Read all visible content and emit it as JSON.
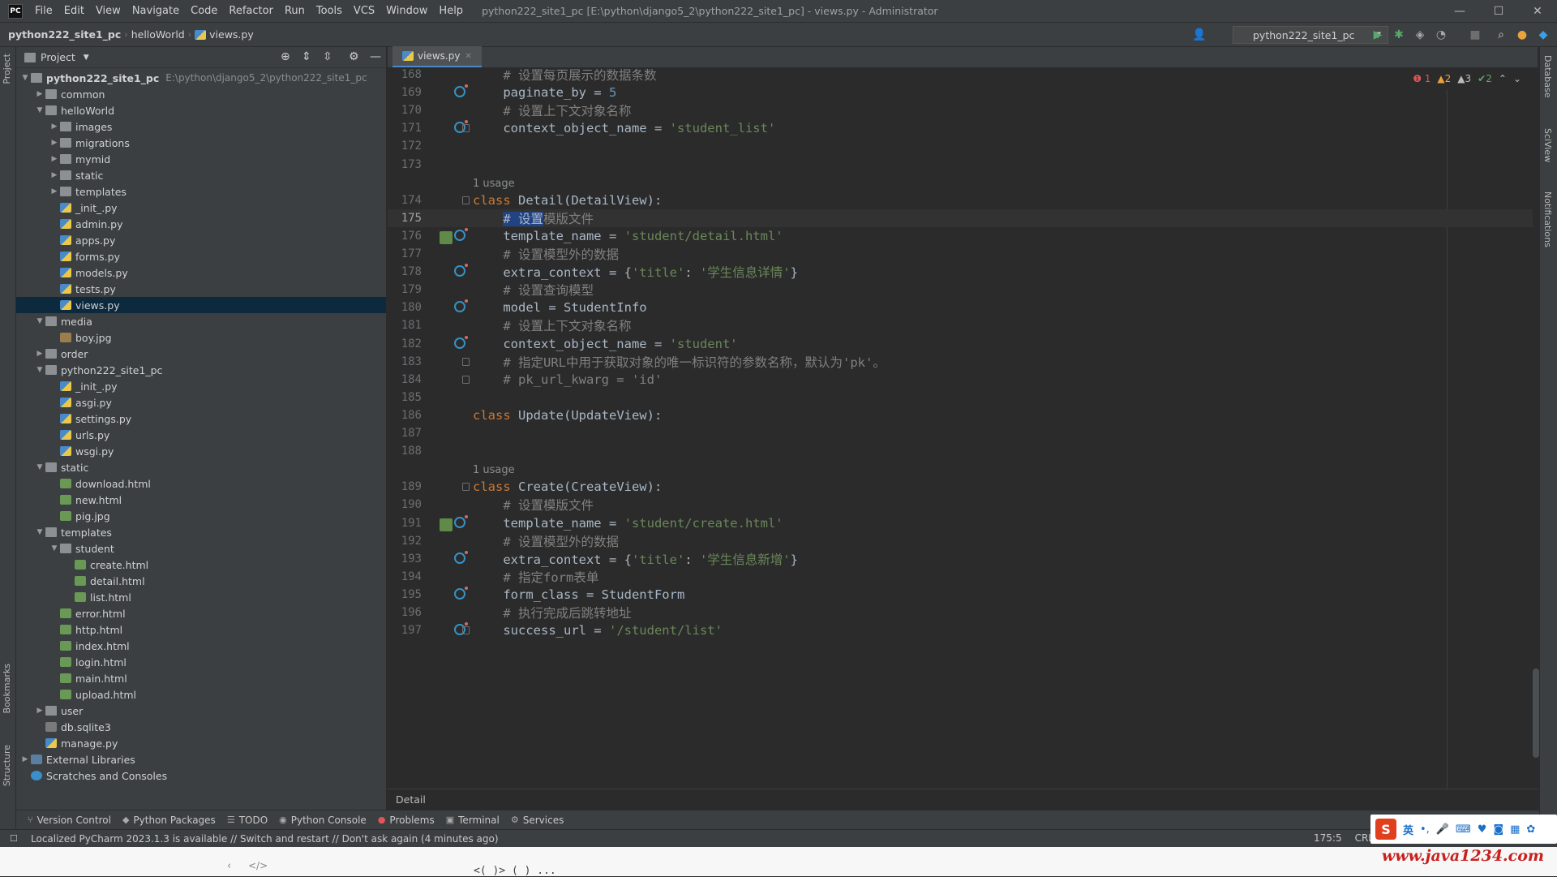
{
  "titlebar": {
    "logo": "PC",
    "menu": [
      "File",
      "Edit",
      "View",
      "Navigate",
      "Code",
      "Refactor",
      "Run",
      "Tools",
      "VCS",
      "Window",
      "Help"
    ],
    "window_title": "python222_site1_pc [E:\\python\\django5_2\\python222_site1_pc] - views.py - Administrator"
  },
  "navbar": {
    "crumbs": [
      "python222_site1_pc",
      "helloWorld",
      "views.py"
    ],
    "run_config": "python222_site1_pc"
  },
  "left_stripe": {
    "project": "Project",
    "bookmarks": "Bookmarks",
    "structure": "Structure"
  },
  "right_stripe": {
    "database": "Database",
    "sciview": "SciView",
    "notifications": "Notifications"
  },
  "project_panel": {
    "title": "Project",
    "tree": [
      {
        "label": "python222_site1_pc",
        "hint": "E:\\python\\django5_2\\python222_site1_pc",
        "type": "folder",
        "depth": 0,
        "arrow": "open",
        "bold": true
      },
      {
        "label": "common",
        "type": "folder",
        "depth": 1,
        "arrow": "closed"
      },
      {
        "label": "helloWorld",
        "type": "folder",
        "depth": 1,
        "arrow": "open"
      },
      {
        "label": "images",
        "type": "folder",
        "depth": 2,
        "arrow": "closed"
      },
      {
        "label": "migrations",
        "type": "folder",
        "depth": 2,
        "arrow": "closed"
      },
      {
        "label": "mymid",
        "type": "folder",
        "depth": 2,
        "arrow": "closed"
      },
      {
        "label": "static",
        "type": "folder",
        "depth": 2,
        "arrow": "closed"
      },
      {
        "label": "templates",
        "type": "folder",
        "depth": 2,
        "arrow": "closed"
      },
      {
        "label": "_init_.py",
        "type": "py",
        "depth": 2
      },
      {
        "label": "admin.py",
        "type": "py",
        "depth": 2
      },
      {
        "label": "apps.py",
        "type": "py",
        "depth": 2
      },
      {
        "label": "forms.py",
        "type": "py",
        "depth": 2
      },
      {
        "label": "models.py",
        "type": "py",
        "depth": 2
      },
      {
        "label": "tests.py",
        "type": "py",
        "depth": 2
      },
      {
        "label": "views.py",
        "type": "py",
        "depth": 2,
        "selected": true
      },
      {
        "label": "media",
        "type": "folder",
        "depth": 1,
        "arrow": "open"
      },
      {
        "label": "boy.jpg",
        "type": "jpg",
        "depth": 2
      },
      {
        "label": "order",
        "type": "folder",
        "depth": 1,
        "arrow": "closed"
      },
      {
        "label": "python222_site1_pc",
        "type": "folder",
        "depth": 1,
        "arrow": "open"
      },
      {
        "label": "_init_.py",
        "type": "py",
        "depth": 2
      },
      {
        "label": "asgi.py",
        "type": "py",
        "depth": 2
      },
      {
        "label": "settings.py",
        "type": "py",
        "depth": 2
      },
      {
        "label": "urls.py",
        "type": "py",
        "depth": 2
      },
      {
        "label": "wsgi.py",
        "type": "py",
        "depth": 2
      },
      {
        "label": "static",
        "type": "folder",
        "depth": 1,
        "arrow": "open"
      },
      {
        "label": "download.html",
        "type": "html",
        "depth": 2
      },
      {
        "label": "new.html",
        "type": "html",
        "depth": 2
      },
      {
        "label": "pig.jpg",
        "type": "html",
        "depth": 2
      },
      {
        "label": "templates",
        "type": "folder",
        "depth": 1,
        "arrow": "open"
      },
      {
        "label": "student",
        "type": "folder",
        "depth": 2,
        "arrow": "open"
      },
      {
        "label": "create.html",
        "type": "html",
        "depth": 3
      },
      {
        "label": "detail.html",
        "type": "html",
        "depth": 3
      },
      {
        "label": "list.html",
        "type": "html",
        "depth": 3
      },
      {
        "label": "error.html",
        "type": "html",
        "depth": 2
      },
      {
        "label": "http.html",
        "type": "html",
        "depth": 2
      },
      {
        "label": "index.html",
        "type": "html",
        "depth": 2
      },
      {
        "label": "login.html",
        "type": "html",
        "depth": 2
      },
      {
        "label": "main.html",
        "type": "html",
        "depth": 2
      },
      {
        "label": "upload.html",
        "type": "html",
        "depth": 2
      },
      {
        "label": "user",
        "type": "folder",
        "depth": 1,
        "arrow": "closed"
      },
      {
        "label": "db.sqlite3",
        "type": "db",
        "depth": 1
      },
      {
        "label": "manage.py",
        "type": "py",
        "depth": 1
      },
      {
        "label": "External Libraries",
        "type": "lib",
        "depth": 0,
        "arrow": "closed"
      },
      {
        "label": "Scratches and Consoles",
        "type": "scratch",
        "depth": 0
      }
    ]
  },
  "editor": {
    "tab": "views.py",
    "inspections": {
      "errors": "1",
      "warnings": "2",
      "weak": "3",
      "ok": "2"
    },
    "lines": [
      {
        "n": "168",
        "code": [
          [
            "cmt",
            "    # 设置每页展示的数据条数"
          ]
        ]
      },
      {
        "n": "169",
        "gutter": "o",
        "code": [
          [
            "cls",
            "    paginate_by = "
          ],
          [
            "num",
            "5"
          ]
        ]
      },
      {
        "n": "170",
        "code": [
          [
            "cmt",
            "    # 设置上下文对象名称"
          ]
        ]
      },
      {
        "n": "171",
        "gutter": "o",
        "fold": true,
        "code": [
          [
            "cls",
            "    context_object_name = "
          ],
          [
            "str",
            "'student_list'"
          ]
        ]
      },
      {
        "n": "172",
        "code": []
      },
      {
        "n": "173",
        "code": []
      },
      {
        "usage": "1 usage"
      },
      {
        "n": "174",
        "fold": true,
        "code": [
          [
            "kw",
            "class "
          ],
          [
            "cls",
            "Detail(DetailView):"
          ]
        ]
      },
      {
        "n": "175",
        "current": true,
        "code": [
          [
            "cmt",
            "    "
          ],
          [
            "sel",
            "# 设置"
          ],
          [
            "cmt",
            "模版文件"
          ]
        ]
      },
      {
        "n": "176",
        "gutter": "io",
        "code": [
          [
            "cls",
            "    template_name = "
          ],
          [
            "str",
            "'student/detail.html'"
          ]
        ]
      },
      {
        "n": "177",
        "code": [
          [
            "cmt",
            "    # 设置模型外的数据"
          ]
        ]
      },
      {
        "n": "178",
        "gutter": "o",
        "code": [
          [
            "cls",
            "    extra_context = {"
          ],
          [
            "str",
            "'title'"
          ],
          [
            "cls",
            ": "
          ],
          [
            "str",
            "'学生信息详情'"
          ],
          [
            "cls",
            "}"
          ]
        ]
      },
      {
        "n": "179",
        "code": [
          [
            "cmt",
            "    # 设置查询模型"
          ]
        ]
      },
      {
        "n": "180",
        "gutter": "o",
        "code": [
          [
            "cls",
            "    model = StudentInfo"
          ]
        ]
      },
      {
        "n": "181",
        "code": [
          [
            "cmt",
            "    # 设置上下文对象名称"
          ]
        ]
      },
      {
        "n": "182",
        "gutter": "o",
        "code": [
          [
            "cls",
            "    context_object_name = "
          ],
          [
            "str",
            "'student'"
          ]
        ]
      },
      {
        "n": "183",
        "fold": true,
        "code": [
          [
            "cmt",
            "    # 指定URL中用于获取对象的唯一标识符的参数名称，默认为'pk'。"
          ]
        ]
      },
      {
        "n": "184",
        "fold": true,
        "code": [
          [
            "cmt",
            "    # pk_url_kwarg = 'id'"
          ]
        ]
      },
      {
        "n": "185",
        "code": []
      },
      {
        "n": "186",
        "code": [
          [
            "kw",
            "class "
          ],
          [
            "cls",
            "Update(UpdateView):"
          ]
        ]
      },
      {
        "n": "187",
        "code": []
      },
      {
        "n": "188",
        "code": []
      },
      {
        "usage": "1 usage"
      },
      {
        "n": "189",
        "fold": true,
        "code": [
          [
            "kw",
            "class "
          ],
          [
            "cls",
            "Create(CreateView):"
          ]
        ]
      },
      {
        "n": "190",
        "code": [
          [
            "cmt",
            "    # 设置模版文件"
          ]
        ]
      },
      {
        "n": "191",
        "gutter": "io",
        "code": [
          [
            "cls",
            "    template_name = "
          ],
          [
            "str",
            "'student/create.html'"
          ]
        ]
      },
      {
        "n": "192",
        "code": [
          [
            "cmt",
            "    # 设置模型外的数据"
          ]
        ]
      },
      {
        "n": "193",
        "gutter": "o",
        "code": [
          [
            "cls",
            "    extra_context = {"
          ],
          [
            "str",
            "'title'"
          ],
          [
            "cls",
            ": "
          ],
          [
            "str",
            "'学生信息新增'"
          ],
          [
            "cls",
            "}"
          ]
        ]
      },
      {
        "n": "194",
        "code": [
          [
            "cmt",
            "    # 指定form表单"
          ]
        ]
      },
      {
        "n": "195",
        "gutter": "o",
        "code": [
          [
            "cls",
            "    form_class = StudentForm"
          ]
        ]
      },
      {
        "n": "196",
        "code": [
          [
            "cmt",
            "    # 执行完成后跳转地址"
          ]
        ]
      },
      {
        "n": "197",
        "gutter": "o",
        "fold": true,
        "code": [
          [
            "cls",
            "    success_url = "
          ],
          [
            "str",
            "'/student/list'"
          ]
        ]
      }
    ],
    "breadcrumb": "Detail"
  },
  "bottom_tools": [
    "Version Control",
    "Python Packages",
    "TODO",
    "Python Console",
    "Problems",
    "Terminal",
    "Services"
  ],
  "status": {
    "message": "Localized PyCharm 2023.1.3 is available // Switch and restart // Don't ask again (4 minutes ago)",
    "position": "175:5",
    "line_sep": "CRLF"
  },
  "ime": {
    "lang": "英"
  },
  "watermark": "www.java1234.com",
  "below_text": "<( )> ( ) ...",
  "colors": {
    "accent": "#4a88c7",
    "keyword": "#cc7832",
    "string": "#6a8759",
    "comment": "#808080",
    "number": "#6897bb",
    "selection": "#214283",
    "watermark": "#c8201e"
  }
}
